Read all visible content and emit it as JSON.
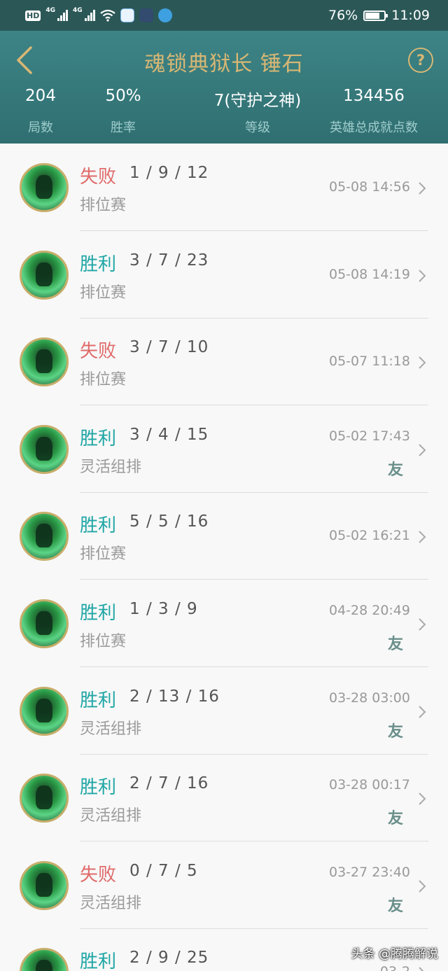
{
  "statusbar": {
    "hd": "HD",
    "net1": "4G",
    "net2": "4G",
    "battery": "76%",
    "time": "11:09"
  },
  "header": {
    "title": "魂锁典狱长 锤石",
    "stats": [
      {
        "value": "204",
        "label": "局数"
      },
      {
        "value": "50%",
        "label": "胜率"
      },
      {
        "value": "7(守护之神)",
        "label": "等级"
      },
      {
        "value": "134456",
        "label": "英雄总成就点数"
      }
    ]
  },
  "matches": [
    {
      "result": "失败",
      "kda": "1 / 9 / 12",
      "mode": "排位赛",
      "time": "05-08 14:56",
      "friend": ""
    },
    {
      "result": "胜利",
      "kda": "3 / 7 / 23",
      "mode": "排位赛",
      "time": "05-08 14:19",
      "friend": ""
    },
    {
      "result": "失败",
      "kda": "3 / 7 / 10",
      "mode": "排位赛",
      "time": "05-07 11:18",
      "friend": ""
    },
    {
      "result": "胜利",
      "kda": "3 / 4 / 15",
      "mode": "灵活组排",
      "time": "05-02 17:43",
      "friend": "友"
    },
    {
      "result": "胜利",
      "kda": "5 / 5 / 16",
      "mode": "排位赛",
      "time": "05-02 16:21",
      "friend": ""
    },
    {
      "result": "胜利",
      "kda": "1 / 3 / 9",
      "mode": "排位赛",
      "time": "04-28 20:49",
      "friend": "友"
    },
    {
      "result": "胜利",
      "kda": "2 / 13 / 16",
      "mode": "灵活组排",
      "time": "03-28 03:00",
      "friend": "友"
    },
    {
      "result": "胜利",
      "kda": "2 / 7 / 16",
      "mode": "灵活组排",
      "time": "03-28 00:17",
      "friend": "友"
    },
    {
      "result": "失败",
      "kda": "0 / 7 / 5",
      "mode": "灵活组排",
      "time": "03-27 23:40",
      "friend": "友"
    },
    {
      "result": "胜利",
      "kda": "2 / 9 / 25",
      "mode": "",
      "time": "03-2",
      "friend": ""
    }
  ],
  "watermark": "头条 @腾腾解说",
  "colors": {
    "win": "#1fa6a5",
    "lose": "#e06a6a",
    "header": "#3d8486",
    "gold": "#d8b774"
  }
}
